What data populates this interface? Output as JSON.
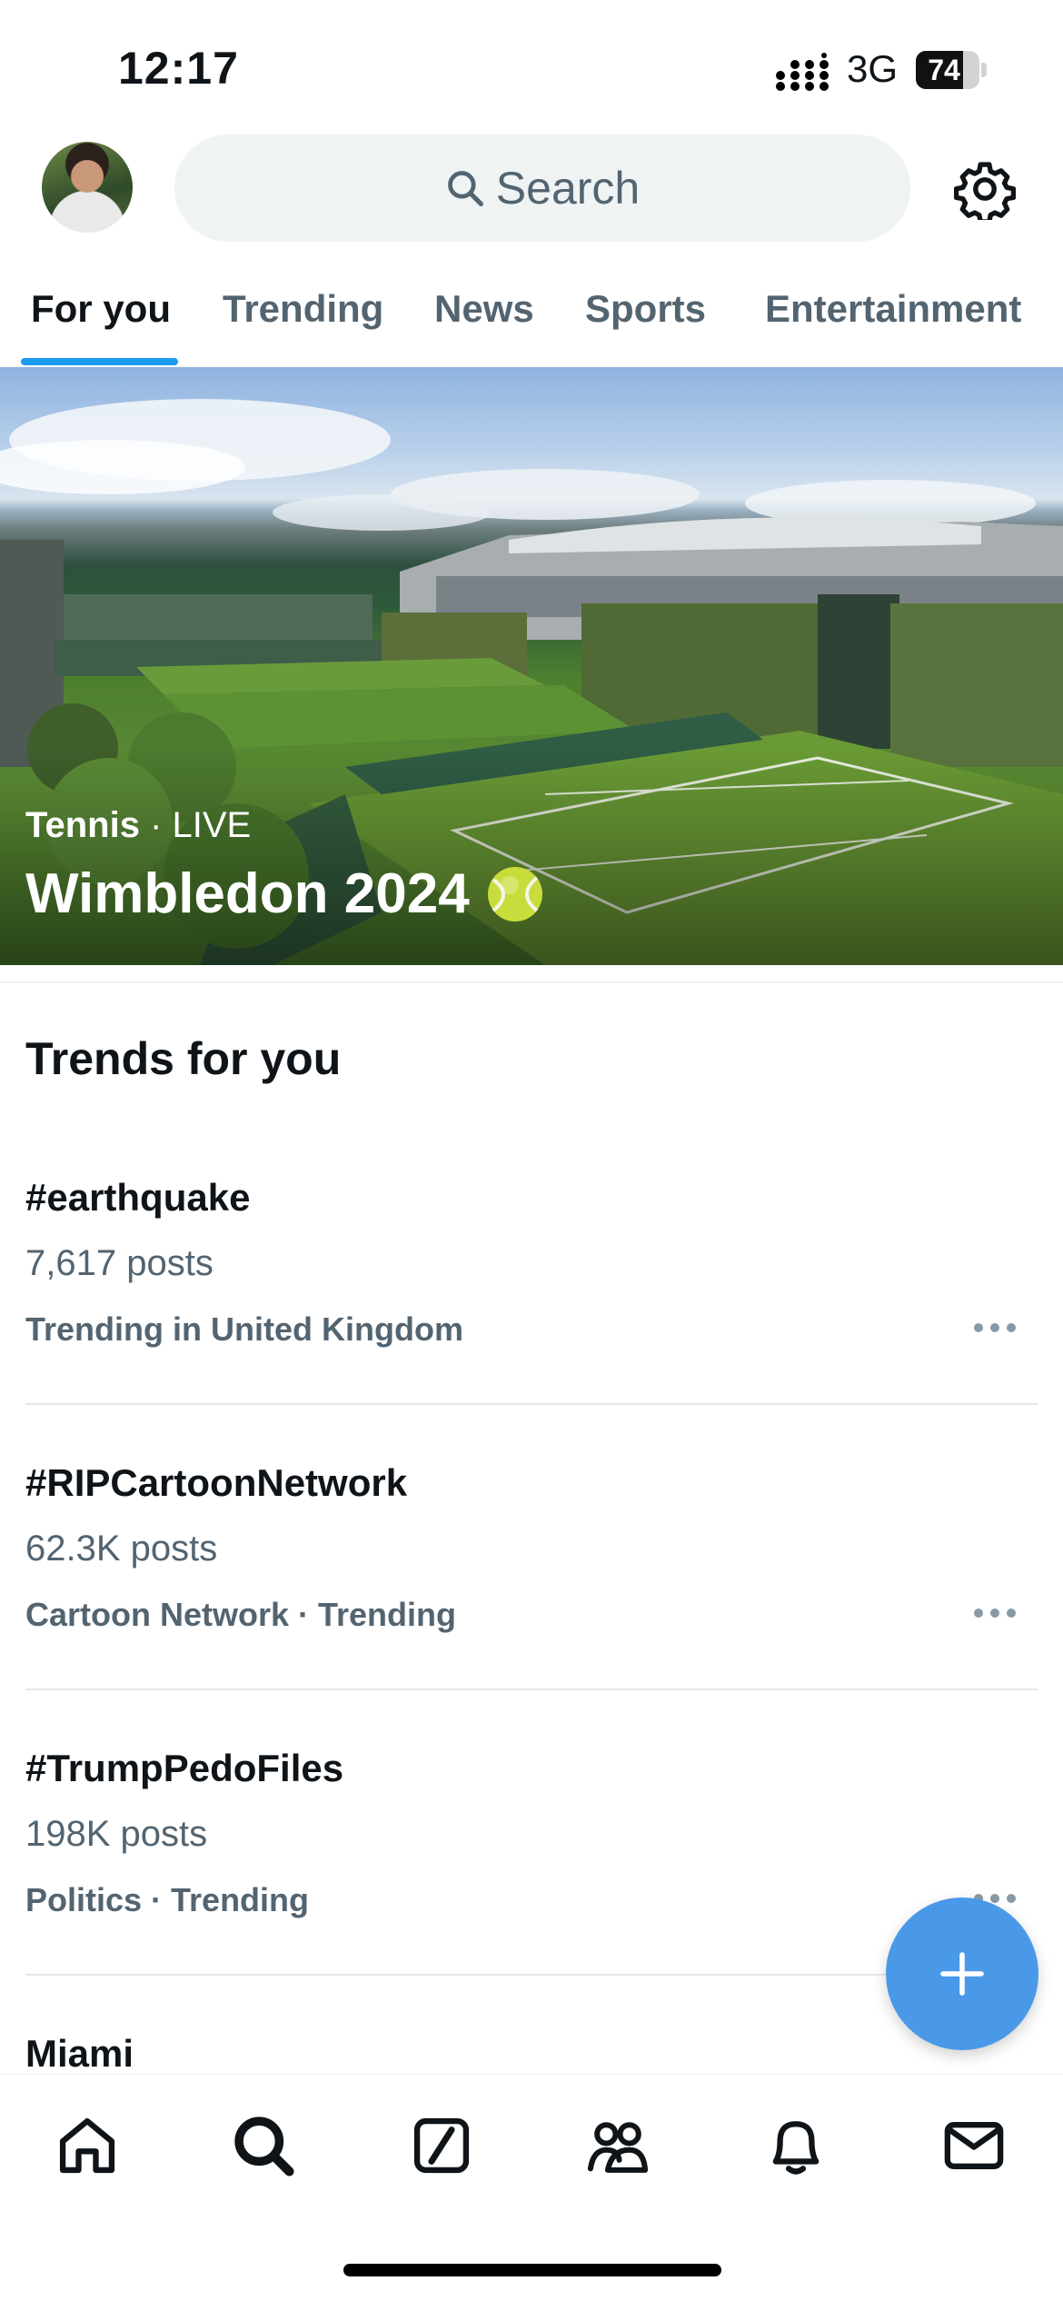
{
  "status_bar": {
    "time": "12:17",
    "network": "3G",
    "battery_level": "74",
    "battery_fraction": 0.74
  },
  "header": {
    "search_placeholder": "Search",
    "icons": [
      "avatar",
      "search-icon",
      "gear-icon"
    ]
  },
  "tabs": [
    {
      "label": "For you",
      "active": true
    },
    {
      "label": "Trending",
      "active": false
    },
    {
      "label": "News",
      "active": false
    },
    {
      "label": "Sports",
      "active": false
    },
    {
      "label": "Entertainment",
      "active": false
    }
  ],
  "hero": {
    "category": "Tennis",
    "separator": " · ",
    "status": "LIVE",
    "title": "Wimbledon 2024",
    "emoji_icon": "tennis-ball-icon"
  },
  "trends_section": {
    "title": "Trends for you",
    "items": [
      {
        "topic": "#earthquake",
        "posts": "7,617 posts",
        "context": "Trending in United Kingdom"
      },
      {
        "topic": "#RIPCartoonNetwork",
        "posts": "62.3K posts",
        "context": "Cartoon Network · Trending"
      },
      {
        "topic": "#TrumpPedoFiles",
        "posts": "198K posts",
        "context": "Politics · Trending"
      },
      {
        "topic": "Miami"
      }
    ]
  },
  "fab": {
    "icon": "plus-icon"
  },
  "bottom_nav": {
    "icons": [
      "home-icon",
      "search-icon",
      "grok-icon",
      "communities-icon",
      "notifications-icon",
      "messages-icon"
    ]
  },
  "colors": {
    "accent": "#1d9bf0",
    "fab": "#4a99e9",
    "text_primary": "#0f1419",
    "text_secondary": "#536471",
    "search_bg": "#eff3f4"
  }
}
